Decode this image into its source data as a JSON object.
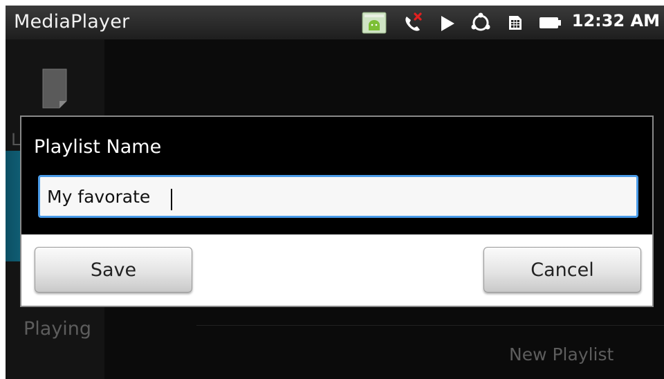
{
  "status_bar": {
    "app_title": "MediaPlayer",
    "time": "12:32 AM",
    "icons": [
      "android-notification-icon",
      "missed-call-icon",
      "play-icon",
      "sync-icon",
      "sim-card-icon",
      "battery-icon"
    ]
  },
  "background": {
    "sidebar_label_partial": "L",
    "sidebar_playing": "Playing",
    "new_playlist": "New Playlist"
  },
  "dialog": {
    "title": "Playlist Name",
    "input_value": "My favorate",
    "save_label": "Save",
    "cancel_label": "Cancel"
  },
  "colors": {
    "input_focus": "#4a9be8",
    "highlight": "#1a8fae"
  }
}
